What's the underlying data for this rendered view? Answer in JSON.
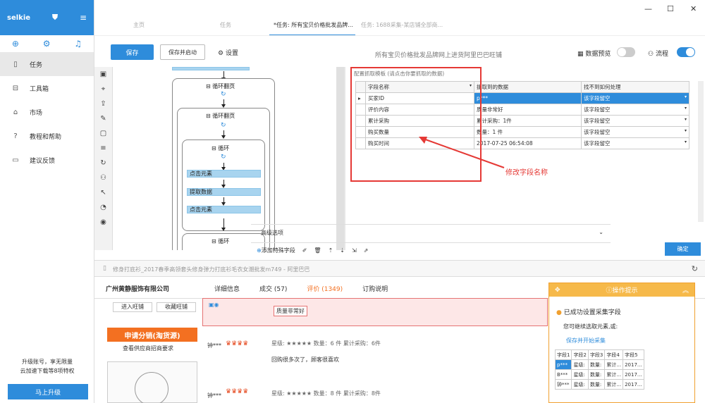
{
  "sidebar": {
    "brand": "selkie",
    "items": [
      {
        "label": "任务",
        "icon": "doc-icon"
      },
      {
        "label": "工具箱",
        "icon": "toolbox-icon"
      },
      {
        "label": "市场",
        "icon": "bag-icon"
      },
      {
        "label": "教程和帮助",
        "icon": "help-icon"
      },
      {
        "label": "建议反馈",
        "icon": "chat-icon"
      }
    ],
    "upgrade_line1": "升级账号，享无限量",
    "upgrade_line2": "云加速下载等8项特权",
    "upgrade_button": "马上升级"
  },
  "tabs": [
    {
      "label": "主页"
    },
    {
      "label": "任务"
    },
    {
      "label": "*任务: 所有宝贝价格批发品牌..."
    },
    {
      "label": "任务: 1688采集-某店铺全部商..."
    }
  ],
  "toolbar": {
    "save": "保存",
    "save_start": "保存并启动",
    "settings": "设置",
    "task_title": "所有宝贝价格批发品牌网上进货阿里巴巴旺铺",
    "preview": "数据预览",
    "flow": "流程"
  },
  "flow": {
    "loop1": "循环翻页",
    "loop2": "循环翻页",
    "loop3": "循环",
    "click1": "点击元素",
    "extract": "提取数据",
    "click2": "点击元素",
    "loop4": "循环"
  },
  "panel": {
    "hint": "配置抓取模板 (请点击你要抓取的数据)",
    "headers": [
      "字段名称",
      "提取到的数据",
      "找不到如何处理"
    ],
    "rows": [
      [
        "买家ID",
        "p***",
        "该字段留空"
      ],
      [
        "评价内容",
        "质量非常好",
        "该字段留空"
      ],
      [
        "累计采购",
        "累计采购：1件",
        "该字段留空"
      ],
      [
        "购买数量",
        "数量：1 件",
        "该字段留空"
      ],
      [
        "购买时间",
        "2017-07-25 06:54:08",
        "该字段留空"
      ]
    ],
    "annotation": "修改字段名称",
    "advanced": "高级选项",
    "add_field": "添加特殊字段",
    "ok": "确定"
  },
  "browser": {
    "url": "修身打底衫_2017春季高领套头修身弹力打底衫毛衣女潮批发m749 - 阿里巴巴",
    "company": "广州黄静服饰有限公司",
    "shop_tabs": [
      "详细信息",
      "成交 (57)",
      "评价 (1349)",
      "订购说明"
    ],
    "enter_shop": "进入旺铺",
    "fav_shop": "收藏旺铺",
    "distribution": "申请分销(淘货源)",
    "recruit": "查看供应商招商要求",
    "review_text": "质量非常好",
    "row1": "星级:  ★★★★★   数量：6 件   累计采购：6件",
    "row1_comment": "回购很多次了，顾客很喜欢",
    "row2": "星级:  ★★★★★   数量：8 件   累计采购：8件",
    "buyer1": "钟***",
    "buyer2": "钟***"
  },
  "popup": {
    "title": "操作提示",
    "msg": "已成功设置采集字段",
    "sub": "您可继续选取元素,或:",
    "link": "保存并开始采集",
    "rows": [
      [
        "字段1",
        "字段2",
        "字段3",
        "字段4",
        "字段5"
      ],
      [
        "p***",
        "星级:",
        "数量:",
        "累计...",
        "2017..."
      ],
      [
        "B***",
        "星级:",
        "数量:",
        "累计...",
        "2017..."
      ],
      [
        "钟***",
        "星级:",
        "数量:",
        "累计...",
        "2017..."
      ]
    ]
  }
}
